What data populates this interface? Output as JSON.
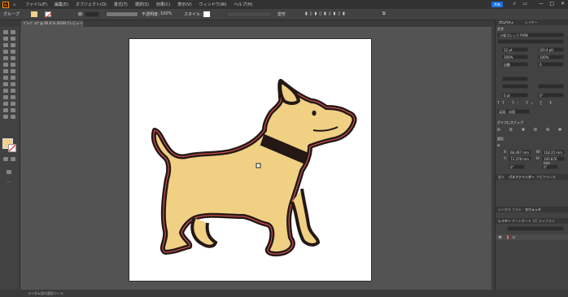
{
  "menubar": {
    "items": [
      "ファイル(F)",
      "編集(E)",
      "オブジェクト(O)",
      "書式(T)",
      "選択(S)",
      "効果(C)",
      "表示(V)",
      "ウィンドウ(W)",
      "ヘルプ(H)"
    ],
    "share_label": "共有"
  },
  "control_bar": {
    "selection_label": "グループ",
    "stroke_label": "線:",
    "opacity_label": "不透明度：",
    "opacity_value": "100%",
    "style_label": "スタイル：",
    "transform_label": "変形"
  },
  "document": {
    "tab_label": "ｸﾞﾙｰﾌﾟ.ai* @ 66.6 % (RGB/プレビュー)"
  },
  "colors": {
    "fill": "#f5d089",
    "dog_fill": "#f0d083",
    "dog_outline": "#231815",
    "selection_outline": "#ee5b5b",
    "collar": "#231815",
    "artboard": "#ffffff",
    "pasteboard": "#535353"
  },
  "status": {
    "text": "ランダム型の変形ツール"
  },
  "panel": {
    "tabs": [
      "プロパティ",
      "レイヤー",
      "CCライブラリ"
    ],
    "active_tab": "プロパティ",
    "character_head": "文字",
    "font_name": "小塚ゴシック Pr6N",
    "font_size": "12 pt",
    "leading": "(20.4 pt)",
    "scale_h": "100%",
    "scale_v": "100%",
    "tracking": "0",
    "kerning": "自動",
    "baseline": "0 pt",
    "rotation": "0°",
    "language": "英語：米国",
    "glyph_head": "グリフにスナップ",
    "transform_head": "変形",
    "x_label": "X：",
    "x_value": "68.497 mm",
    "y_label": "Y：",
    "y_value": "73.378 mm",
    "w_label": "W：",
    "w_value": "118.35 mm",
    "h_label": "H：",
    "h_value": "100.876 mm",
    "angle": "0°",
    "shear": "0°",
    "lower_tabs_1": [
      "塗り",
      "パスファインダー",
      "アピアランス"
    ],
    "lower_tabs_2": [
      "スウォッチ",
      "ブラシ",
      "シンボル"
    ],
    "layers_tabs": [
      "レイヤー",
      "アートボード",
      "CC ライブラリ"
    ],
    "layer_name": "ｲﾇ"
  }
}
